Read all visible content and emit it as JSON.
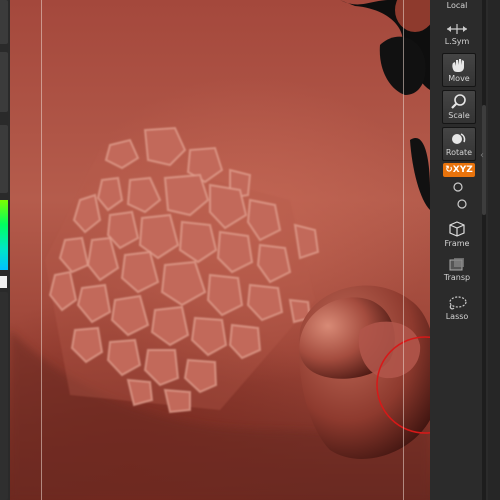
{
  "right_toolbar": {
    "local_label": "Local",
    "lsym_label": "L.Sym",
    "move_label": "Move",
    "scale_label": "Scale",
    "rotate_label": "Rotate",
    "xyz_label": "XYZ",
    "frame_label": "Frame",
    "transp_label": "Transp",
    "lasso_label": "Lasso",
    "xyz_color": "#e8730c"
  },
  "viewport": {
    "sculpt_color": "#a4483c"
  }
}
